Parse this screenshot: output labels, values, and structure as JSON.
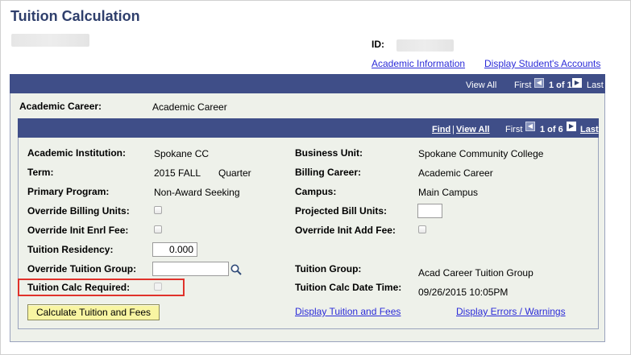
{
  "page": {
    "title": "Tuition Calculation",
    "id_label": "ID:",
    "links": {
      "academic_information": "Academic Information",
      "display_accounts": "Display Student's Accounts"
    }
  },
  "outer_grid": {
    "view_all": "View All",
    "first": "First",
    "count": "1 of 1",
    "last": "Last",
    "academic_career_label": "Academic Career:",
    "academic_career_value": "Academic Career"
  },
  "inner_grid": {
    "find": "Find",
    "separator": "|",
    "view_all": "View All",
    "first": "First",
    "count": "1 of 6",
    "last": "Last"
  },
  "fields": {
    "academic_institution": {
      "label": "Academic Institution:",
      "value": "Spokane CC"
    },
    "term": {
      "label": "Term:",
      "value": "2015 FALL",
      "value2": "Quarter"
    },
    "primary_program": {
      "label": "Primary Program:",
      "value": "Non-Award Seeking"
    },
    "override_billing_units": {
      "label": "Override Billing Units:"
    },
    "override_init_enrl_fee": {
      "label": "Override Init Enrl Fee:"
    },
    "tuition_residency": {
      "label": "Tuition Residency:",
      "value": "0.000"
    },
    "override_tuition_group": {
      "label": "Override Tuition Group:",
      "value": ""
    },
    "tuition_calc_required": {
      "label": "Tuition Calc Required:"
    },
    "business_unit": {
      "label": "Business Unit:",
      "value": "Spokane Community College"
    },
    "billing_career": {
      "label": "Billing Career:",
      "value": "Academic Career"
    },
    "campus": {
      "label": "Campus:",
      "value": "Main Campus"
    },
    "projected_bill_units": {
      "label": "Projected Bill Units:",
      "value": ""
    },
    "override_init_add_fee": {
      "label": "Override Init Add Fee:"
    },
    "tuition_group": {
      "label": "Tuition Group:",
      "value": "Acad Career Tuition Group"
    },
    "tuition_calc_datetime": {
      "label": "Tuition Calc Date Time:",
      "value": "09/26/2015 10:05PM"
    }
  },
  "actions": {
    "calculate": "Calculate Tuition and Fees",
    "display_tuition": "Display Tuition and Fees",
    "display_errors": "Display Errors / Warnings"
  },
  "colors": {
    "header_bar": "#3f4e88",
    "panel_bg": "#eef1ea",
    "title": "#2f3f6c",
    "link": "#2b2bd8",
    "highlight": "#e0322b",
    "button_bg": "#f8f5a2"
  }
}
